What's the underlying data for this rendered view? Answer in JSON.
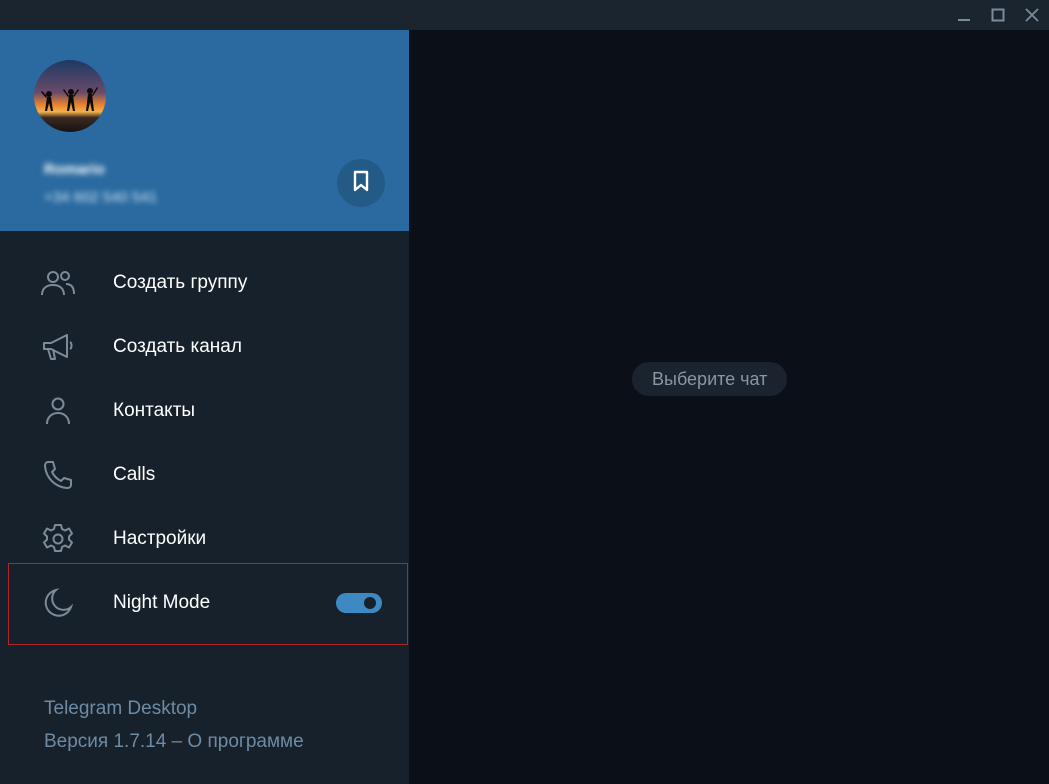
{
  "window": {
    "controls": [
      "minimize-icon",
      "maximize-icon",
      "close-icon"
    ]
  },
  "profile": {
    "name": "Romario",
    "phone": "+34 602 540 541",
    "saved_messages_icon": "bookmark-icon"
  },
  "menu": [
    {
      "label": "Создать группу",
      "icon": "group-icon"
    },
    {
      "label": "Создать канал",
      "icon": "megaphone-icon"
    },
    {
      "label": "Контакты",
      "icon": "person-icon"
    },
    {
      "label": "Calls",
      "icon": "phone-icon"
    },
    {
      "label": "Настройки",
      "icon": "gear-icon"
    },
    {
      "label": "Night Mode",
      "icon": "moon-icon",
      "toggle_on": true
    }
  ],
  "footer": {
    "app_name": "Telegram Desktop",
    "version": "Версия 1.7.14 – О программе"
  },
  "main": {
    "placeholder": "Выберите чат"
  },
  "colors": {
    "accent": "#2a6aa0",
    "toggle": "#3d8ac2",
    "sidebar": "#17212b",
    "background": "#0b0f18",
    "highlight": "#b3252a"
  }
}
